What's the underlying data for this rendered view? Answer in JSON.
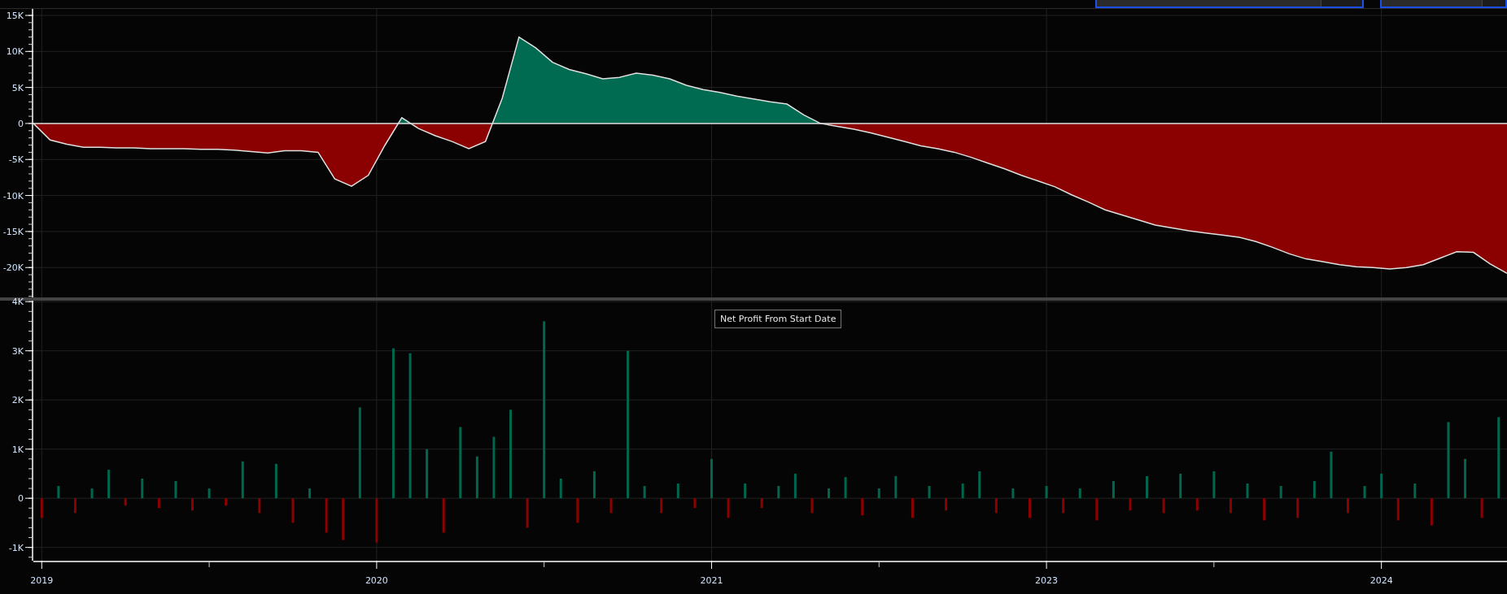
{
  "toolbar": {
    "dropdowns": [
      {
        "kind": "metric"
      },
      {
        "kind": "period"
      }
    ]
  },
  "profit_chart": {
    "chart_data": {
      "type": "area",
      "grid": true,
      "ylim": [
        -24150,
        15900
      ],
      "yticks": [
        {
          "value": 15000,
          "label": "15K"
        },
        {
          "value": 10000,
          "label": "10K"
        },
        {
          "value": 5000,
          "label": "5K"
        },
        {
          "value": 0,
          "label": "0"
        },
        {
          "value": -5000,
          "label": "-5K"
        },
        {
          "value": -10000,
          "label": "-10K"
        },
        {
          "value": -15000,
          "label": "-15K"
        },
        {
          "value": -20000,
          "label": "-20K"
        }
      ],
      "categories": [
        null,
        null,
        null,
        null,
        null,
        null,
        null,
        null,
        null,
        null,
        null,
        null,
        null,
        null,
        null,
        null,
        null,
        null,
        null,
        null,
        null,
        null,
        null,
        null,
        null,
        null,
        null,
        null,
        null,
        null,
        null,
        null,
        null,
        null,
        null,
        null,
        null,
        null,
        null,
        null,
        null,
        null,
        null,
        null,
        null,
        null,
        null,
        null,
        null,
        null,
        null,
        null,
        null,
        null,
        null,
        null,
        null,
        null,
        null,
        null,
        null,
        null,
        null,
        null,
        null,
        null,
        null,
        null,
        null,
        null,
        null,
        null,
        null,
        null,
        null,
        null,
        null,
        null,
        null,
        null,
        null,
        null,
        null,
        null,
        null,
        null,
        null,
        null,
        null
      ],
      "series": [
        {
          "values": [
            0,
            -2300,
            -2900,
            -3300,
            -3300,
            -3400,
            -3400,
            -3500,
            -3500,
            -3500,
            -3600,
            -3600,
            -3700,
            -3900,
            -4100,
            -3800,
            -3800,
            -4000,
            -7700,
            -8700,
            -7200,
            -3000,
            800,
            -700,
            -1700,
            -2500,
            -3500,
            -2500,
            3500,
            12000,
            10500,
            8500,
            7500,
            6900,
            6200,
            6400,
            7000,
            6700,
            6200,
            5300,
            4700,
            4300,
            3800,
            3400,
            3000,
            2700,
            1200,
            0,
            -400,
            -800,
            -1300,
            -1900,
            -2500,
            -3100,
            -3500,
            -4000,
            -4700,
            -5500,
            -6300,
            -7200,
            -8000,
            -8800,
            -9900,
            -10900,
            -12000,
            -12700,
            -13400,
            -14100,
            -14500,
            -14900,
            -15200,
            -15500,
            -15800,
            -16400,
            -17200,
            -18100,
            -18800,
            -19200,
            -19600,
            -19900,
            -20000,
            -20200,
            -20000,
            -19600,
            -18700,
            -17800,
            -17900,
            -19500,
            -20800
          ]
        }
      ]
    }
  },
  "daily_chart": {
    "legend": "Net Profit From Start Date",
    "chart_data": {
      "type": "bar",
      "grid": true,
      "ylim": [
        -1270,
        4020
      ],
      "yticks": [
        {
          "value": 4000,
          "label": "4K"
        },
        {
          "value": 3000,
          "label": "3K"
        },
        {
          "value": 2000,
          "label": "2K"
        },
        {
          "value": 1000,
          "label": "1K"
        },
        {
          "value": 0,
          "label": "0"
        },
        {
          "value": -1000,
          "label": "-1K"
        }
      ],
      "categories": [
        "2019",
        null,
        null,
        null,
        null,
        null,
        null,
        null,
        null,
        null,
        null,
        null,
        null,
        null,
        null,
        null,
        null,
        null,
        null,
        null,
        "2020",
        null,
        null,
        null,
        null,
        null,
        null,
        null,
        null,
        null,
        null,
        null,
        null,
        null,
        null,
        null,
        null,
        null,
        null,
        null,
        "2021",
        null,
        null,
        null,
        null,
        null,
        null,
        null,
        null,
        null,
        null,
        null,
        null,
        null,
        null,
        null,
        null,
        null,
        null,
        null,
        "2023",
        null,
        null,
        null,
        null,
        null,
        null,
        null,
        null,
        null,
        null,
        null,
        null,
        null,
        null,
        null,
        null,
        null,
        null,
        null,
        "2024",
        null,
        null,
        null,
        null,
        null,
        null,
        null
      ],
      "series": [
        {
          "values": [
            -400,
            250,
            -300,
            200,
            580,
            -150,
            400,
            -200,
            350,
            -250,
            200,
            -150,
            750,
            -300,
            700,
            -500,
            200,
            -700,
            -850,
            1850,
            -900,
            3050,
            2950,
            1000,
            -700,
            1450,
            850,
            1250,
            1800,
            -600,
            3600,
            400,
            -500,
            550,
            -300,
            3000,
            250,
            -300,
            300,
            -200,
            800,
            -400,
            300,
            -200,
            250,
            500,
            -300,
            200,
            430,
            -350,
            200,
            450,
            -400,
            250,
            -250,
            300,
            550,
            -300,
            200,
            -400,
            250,
            -300,
            200,
            -450,
            350,
            -250,
            450,
            -300,
            500,
            -250,
            550,
            -300,
            300,
            -450,
            250,
            -400,
            350,
            950,
            -300,
            250,
            500,
            -450,
            300,
            -550,
            1550,
            800,
            -400,
            1650
          ]
        }
      ]
    }
  }
}
